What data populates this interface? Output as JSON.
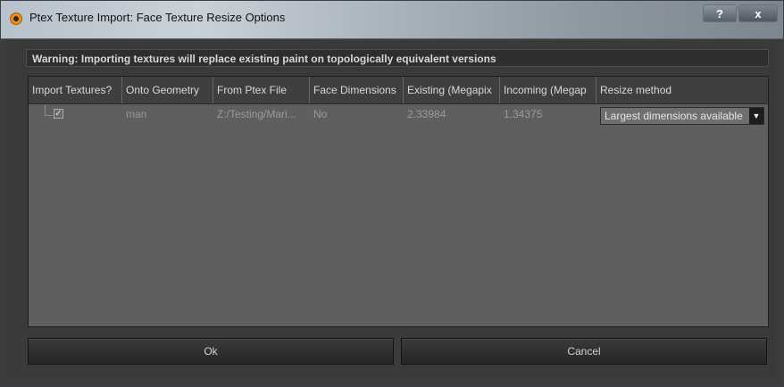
{
  "window": {
    "title": "Ptex Texture Import: Face Texture Resize Options",
    "help_label": "?",
    "close_label": "x"
  },
  "warning": "Warning: Importing textures will replace existing paint on topologically equivalent versions",
  "table": {
    "headers": [
      "Import Textures?",
      "Onto Geometry",
      "From Ptex File",
      "Face Dimensions",
      "Existing (Megapix",
      "Incoming (Megap",
      "Resize method"
    ],
    "row": {
      "checked_glyph": "✓",
      "geometry": "man",
      "ptex_file": "Z:/Testing/Mari...",
      "face_dimensions": "No",
      "existing": "2.33984",
      "incoming": "1.34375",
      "resize_method": "Largest dimensions available"
    }
  },
  "buttons": {
    "ok": "Ok",
    "cancel": "Cancel"
  },
  "icons": {
    "app": "mari-app-icon",
    "dropdown": "chevron-down-icon"
  },
  "colors": {
    "accent": "#f08c1a",
    "table_bg": "#5f5f5f",
    "header_bg": "#3f3f3f"
  }
}
